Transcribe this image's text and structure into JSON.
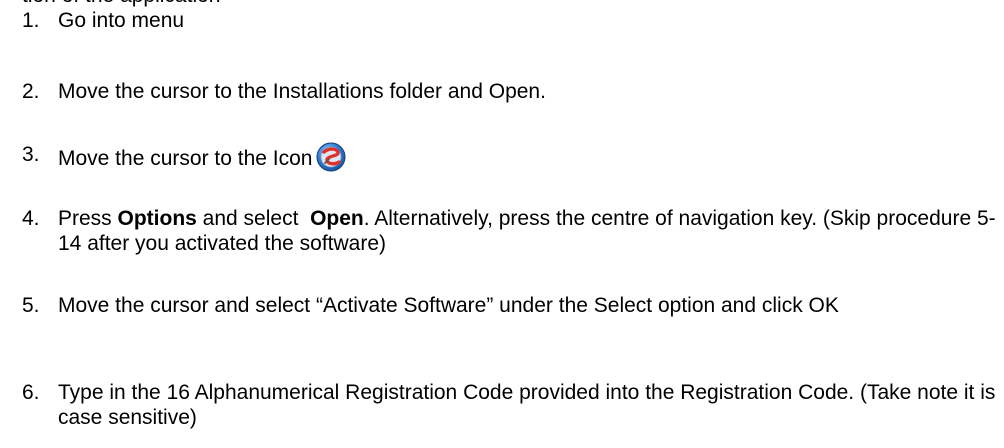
{
  "cutoff_line": "tion of the application",
  "steps": [
    {
      "num": "1.",
      "text": "Go into menu"
    },
    {
      "num": "2.",
      "text": "Move the cursor to the Installations folder and Open."
    },
    {
      "num": "3.",
      "text": "Move the cursor to the Icon",
      "icon": "app-swirl-icon"
    },
    {
      "num": "4.",
      "pre": "Press ",
      "bold1": "Options",
      "mid": " and select  ",
      "bold2": "Open",
      "post": ". Alternatively, press the centre of navigation key. (Skip procedure 5-14 after you activated the software)"
    },
    {
      "num": "5.",
      "text": "Move the cursor and select “Activate Software” under the Select option and click OK"
    },
    {
      "num": "6.",
      "text": "Type in the 16 Alphanumerical Registration Code provided into the Registration Code. (Take note it is case sensitive)"
    }
  ],
  "colors": {
    "icon_blue": "#2f7fd6",
    "icon_red": "#e0322a",
    "text": "#000000"
  }
}
